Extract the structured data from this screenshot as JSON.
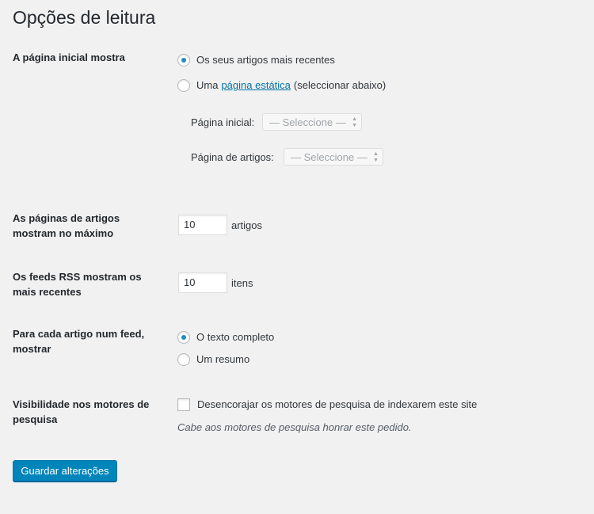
{
  "title": "Opções de leitura",
  "front_page": {
    "label": "A página inicial mostra",
    "option_latest": "Os seus artigos mais recentes",
    "option_static_prefix": "Uma",
    "option_static_link": "página estática",
    "option_static_suffix": "(seleccionar abaixo)",
    "selected": "latest",
    "homepage_label": "Página inicial:",
    "homepage_select": "— Seleccione —",
    "posts_page_label": "Página de artigos:",
    "posts_page_select": "— Seleccione —"
  },
  "posts_per_page": {
    "label": "As páginas de artigos mostram no máximo",
    "value": "10",
    "unit": "artigos"
  },
  "rss_items": {
    "label": "Os feeds RSS mostram os mais recentes",
    "value": "10",
    "unit": "itens"
  },
  "feed_article": {
    "label": "Para cada artigo num feed, mostrar",
    "option_full": "O texto completo",
    "option_summary": "Um resumo",
    "selected": "full"
  },
  "search_visibility": {
    "label": "Visibilidade nos motores de pesquisa",
    "checkbox_label": "Desencorajar os motores de pesquisa de indexarem este site",
    "checked": false,
    "description": "Cabe aos motores de pesquisa honrar este pedido."
  },
  "save_button": "Guardar alterações",
  "colors": {
    "background": "#f1f1f1",
    "accent": "#0085ba",
    "link": "#0073aa",
    "radio_dot": "#1e8cbe"
  }
}
